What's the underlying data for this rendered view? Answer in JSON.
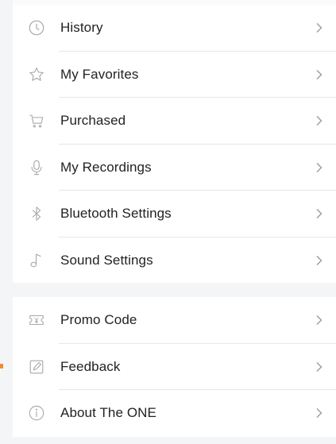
{
  "menu_group_1": [
    {
      "label": "History",
      "icon": "clock-icon"
    },
    {
      "label": "My Favorites",
      "icon": "star-icon"
    },
    {
      "label": "Purchased",
      "icon": "cart-icon"
    },
    {
      "label": "My Recordings",
      "icon": "microphone-icon"
    },
    {
      "label": "Bluetooth Settings",
      "icon": "bluetooth-icon"
    },
    {
      "label": "Sound Settings",
      "icon": "music-note-icon"
    }
  ],
  "menu_group_2": [
    {
      "label": "Promo Code",
      "icon": "ticket-icon"
    },
    {
      "label": "Feedback",
      "icon": "edit-icon"
    },
    {
      "label": "About The ONE",
      "icon": "info-icon"
    }
  ],
  "colors": {
    "background": "#f4f5f7",
    "card": "#ffffff",
    "text": "#222222",
    "icon": "#a7a7ad",
    "accent_mark": "#f08a24"
  }
}
